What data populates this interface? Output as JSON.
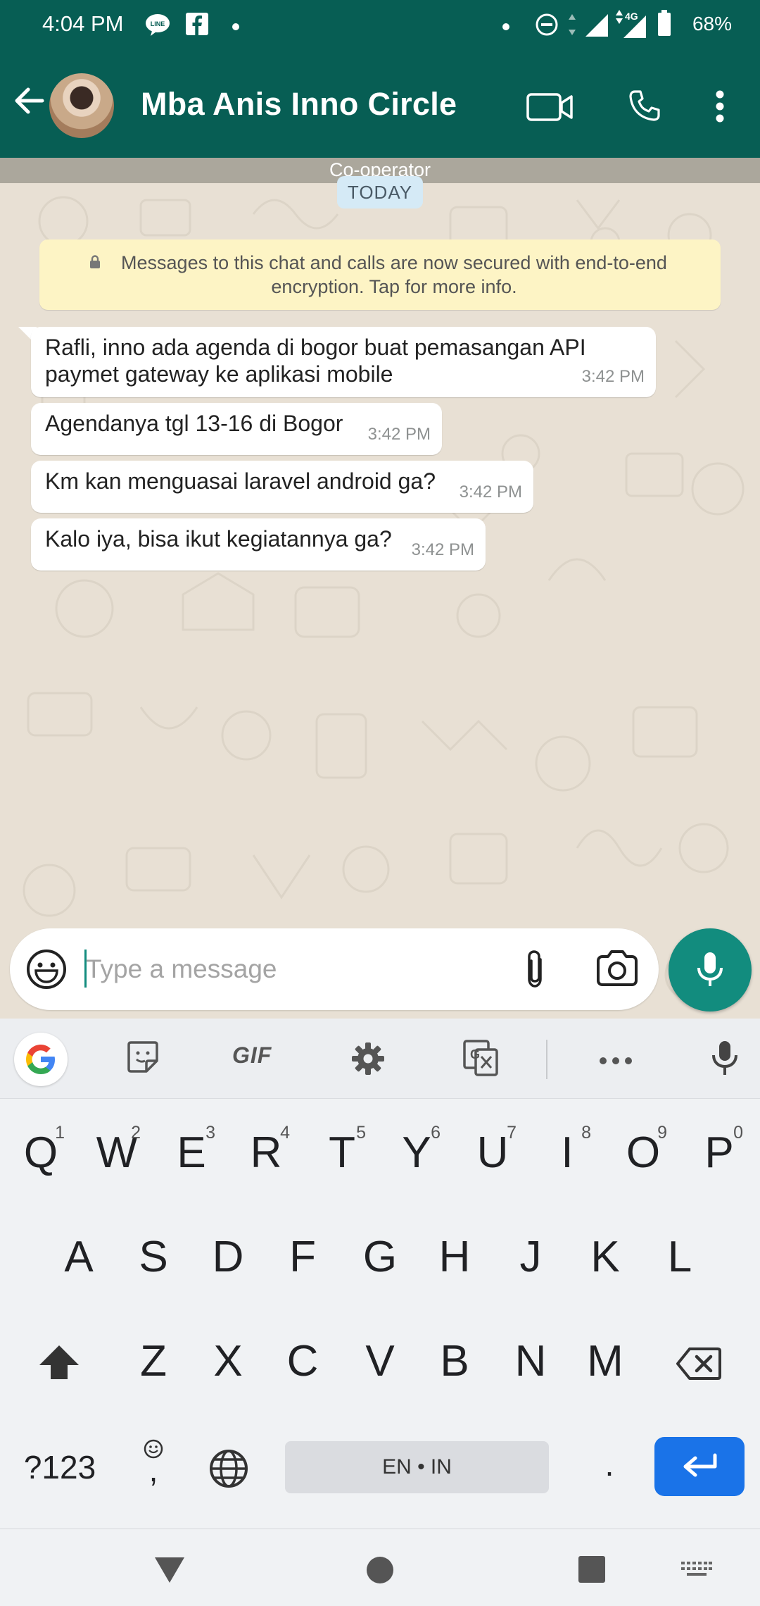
{
  "status_bar": {
    "time": "4:04 PM",
    "battery": "68%",
    "network": "4G"
  },
  "header": {
    "contact_name": "Mba Anis Inno Circle",
    "icons": [
      "back-arrow-icon",
      "avatar",
      "video-call-icon",
      "voice-call-icon",
      "more-options-icon"
    ]
  },
  "chat": {
    "subtitle": "Co-operator",
    "date_chip": "TODAY",
    "encryption_notice": "Messages to this chat and calls are now secured with end-to-end encryption. Tap for more info.",
    "messages": [
      {
        "text_line1": "Rafli, inno ada agenda di bogor buat pemasangan API",
        "text_line2": "paymet gateway ke aplikasi mobile",
        "time": "3:42 PM"
      },
      {
        "text": "Agendanya tgl 13-16 di Bogor",
        "time": "3:42 PM"
      },
      {
        "text": "Km kan menguasai laravel android ga?",
        "time": "3:42 PM"
      },
      {
        "text": "Kalo iya, bisa ikut kegiatannya ga?",
        "time": "3:42 PM"
      }
    ]
  },
  "composer": {
    "placeholder": "Type a message",
    "value": ""
  },
  "keyboard": {
    "toolbar": {
      "gif_label": "GIF"
    },
    "row1": [
      {
        "key": "Q",
        "hint": "1"
      },
      {
        "key": "W",
        "hint": "2"
      },
      {
        "key": "E",
        "hint": "3"
      },
      {
        "key": "R",
        "hint": "4"
      },
      {
        "key": "T",
        "hint": "5"
      },
      {
        "key": "Y",
        "hint": "6"
      },
      {
        "key": "U",
        "hint": "7"
      },
      {
        "key": "I",
        "hint": "8"
      },
      {
        "key": "O",
        "hint": "9"
      },
      {
        "key": "P",
        "hint": "0"
      }
    ],
    "row2": [
      "A",
      "S",
      "D",
      "F",
      "G",
      "H",
      "J",
      "K",
      "L"
    ],
    "row3": [
      "Z",
      "X",
      "C",
      "V",
      "B",
      "N",
      "M"
    ],
    "symbols_label": "?123",
    "comma_label": ",",
    "space_label": "EN • IN",
    "period_label": ".",
    "accent_color": "#1a73e8"
  },
  "colors": {
    "whatsapp_dark": "#075e54",
    "whatsapp_teal": "#128c7e"
  }
}
